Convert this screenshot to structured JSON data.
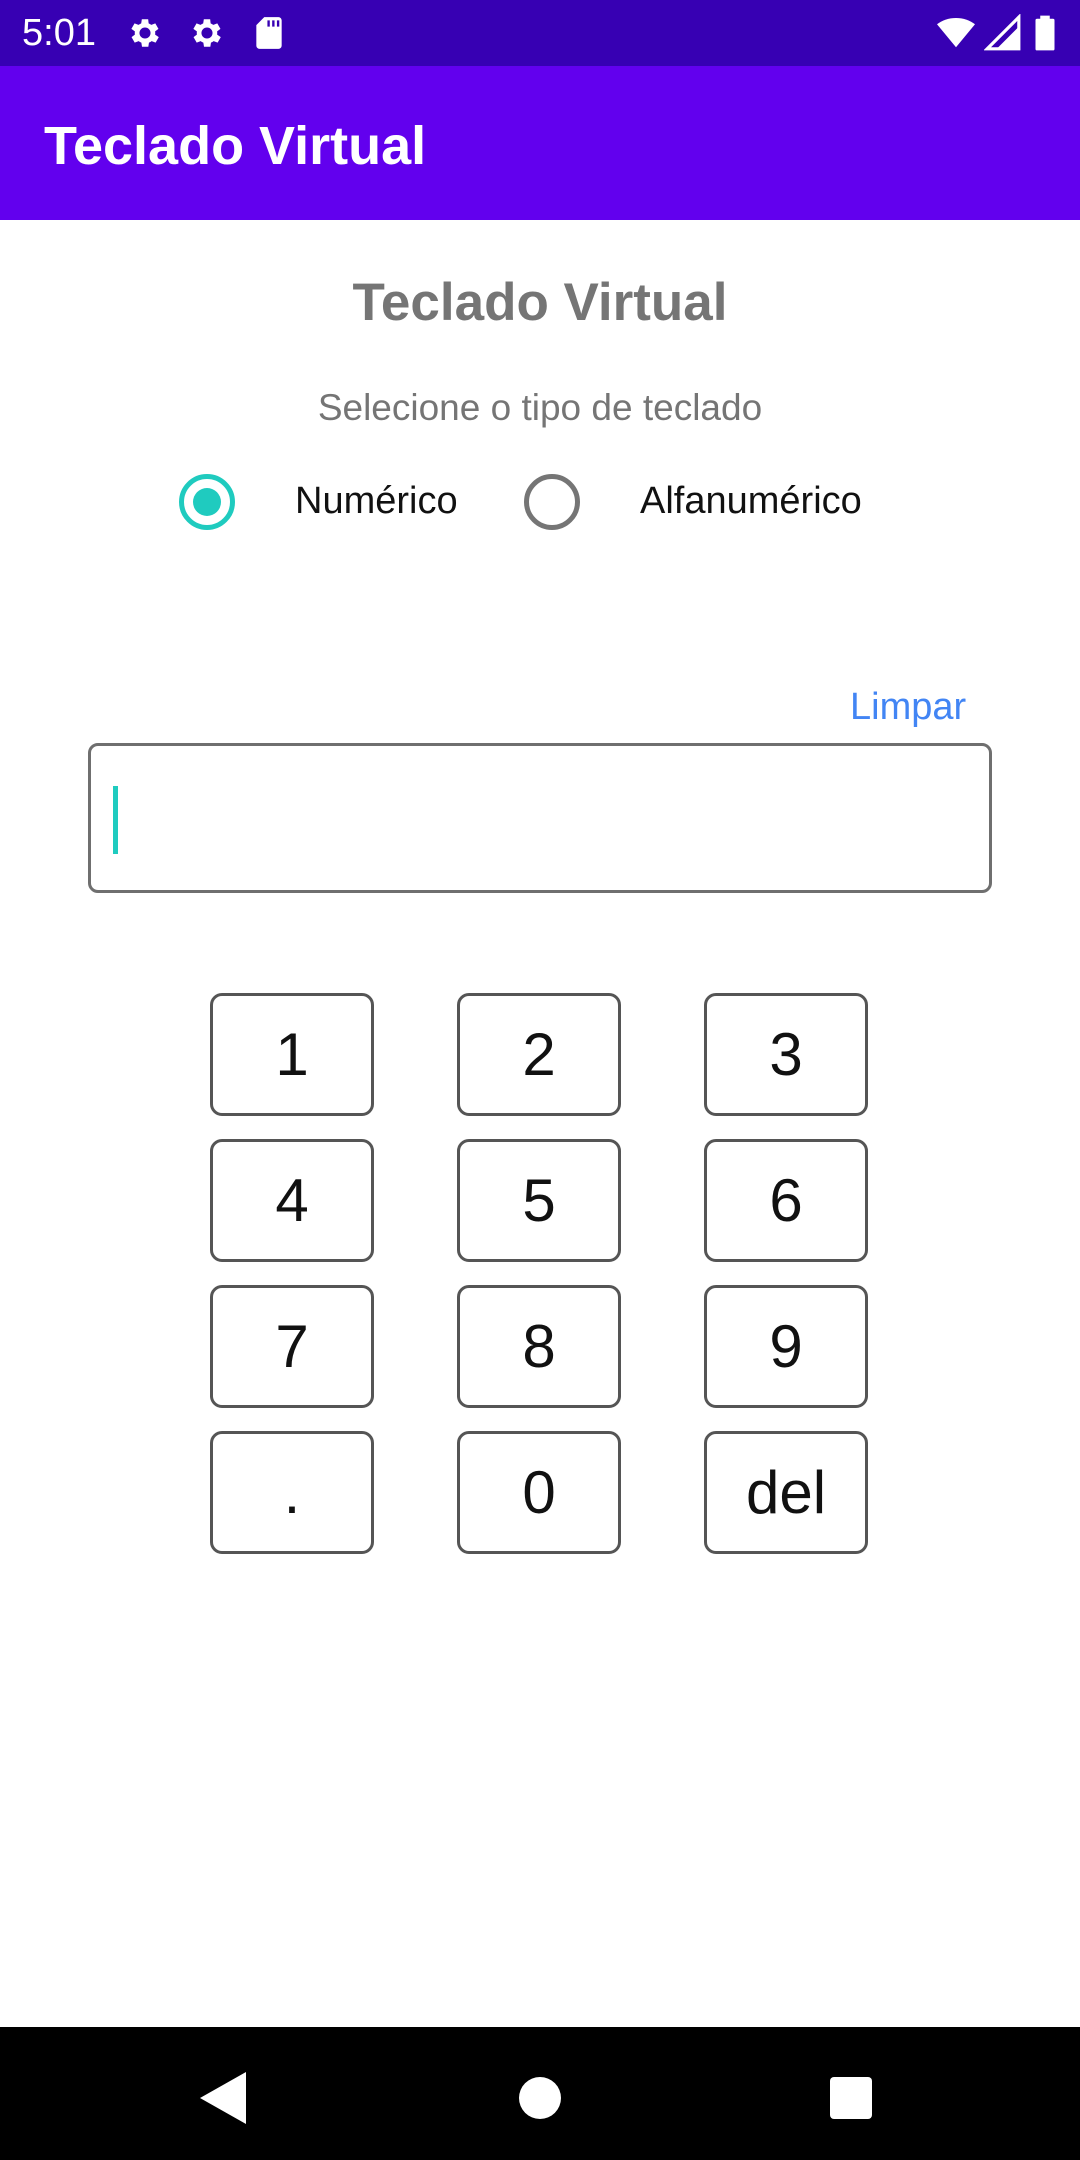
{
  "status_bar": {
    "time": "5:01",
    "icons": [
      "settings-icon",
      "settings-icon",
      "sd-card-icon",
      "wifi-icon",
      "signal-icon",
      "battery-icon"
    ]
  },
  "app_bar": {
    "title": "Teclado Virtual"
  },
  "main": {
    "title": "Teclado Virtual",
    "subtitle": "Selecione o tipo de teclado",
    "radio_options": [
      {
        "label": "Numérico",
        "selected": true
      },
      {
        "label": "Alfanumérico",
        "selected": false
      }
    ],
    "clear_label": "Limpar",
    "input_value": ""
  },
  "keypad": {
    "keys": [
      "1",
      "2",
      "3",
      "4",
      "5",
      "6",
      "7",
      "8",
      "9",
      ".",
      "0",
      "del"
    ]
  },
  "colors": {
    "status_bar": "#3700b3",
    "app_bar": "#6200ee",
    "accent": "#1fcbbf",
    "link": "#4285f4"
  },
  "nav_bar": {
    "icons": [
      "back-icon",
      "home-icon",
      "recents-icon"
    ]
  }
}
